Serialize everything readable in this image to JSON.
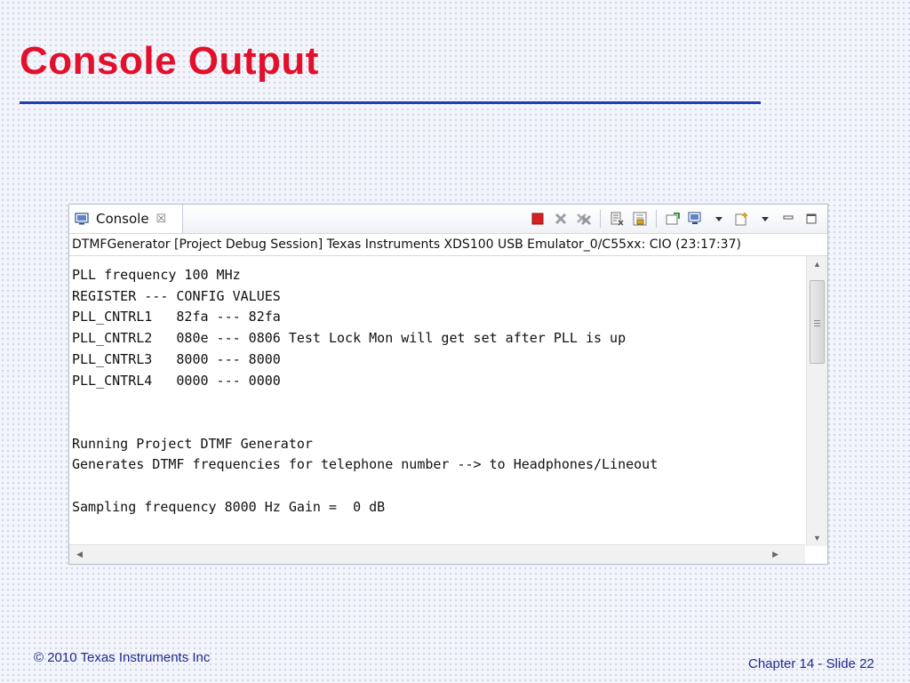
{
  "slide": {
    "title": "Console Output",
    "footer_left": "© 2010 Texas Instruments Inc",
    "footer_right": "Chapter 14 - Slide 22"
  },
  "console": {
    "tab_label": "Console",
    "tab_close_glyph": "☒",
    "session_line": "DTMFGenerator [Project Debug Session] Texas Instruments XDS100 USB Emulator_0/C55xx: CIO (23:17:37)",
    "output_lines": [
      "PLL frequency 100 MHz",
      "REGISTER --- CONFIG VALUES",
      "PLL_CNTRL1   82fa --- 82fa",
      "PLL_CNTRL2   080e --- 0806 Test Lock Mon will get set after PLL is up",
      "PLL_CNTRL3   8000 --- 8000",
      "PLL_CNTRL4   0000 --- 0000",
      "",
      "",
      "Running Project DTMF Generator",
      "Generates DTMF frequencies for telephone number --> to Headphones/Lineout",
      "",
      "Sampling frequency 8000 Hz Gain =  0 dB"
    ],
    "toolbar_icons": [
      "terminate-icon",
      "remove-launch-icon",
      "remove-all-launches-icon",
      "clear-console-icon",
      "scroll-lock-icon",
      "pin-console-icon",
      "display-selected-console-icon",
      "open-console-icon",
      "minimize-icon",
      "maximize-icon"
    ],
    "colors": {
      "terminate": "#d42020",
      "title_red": "#e3102c",
      "rule_blue": "#1f3fb6",
      "footer_blue": "#1f2a8a"
    }
  }
}
